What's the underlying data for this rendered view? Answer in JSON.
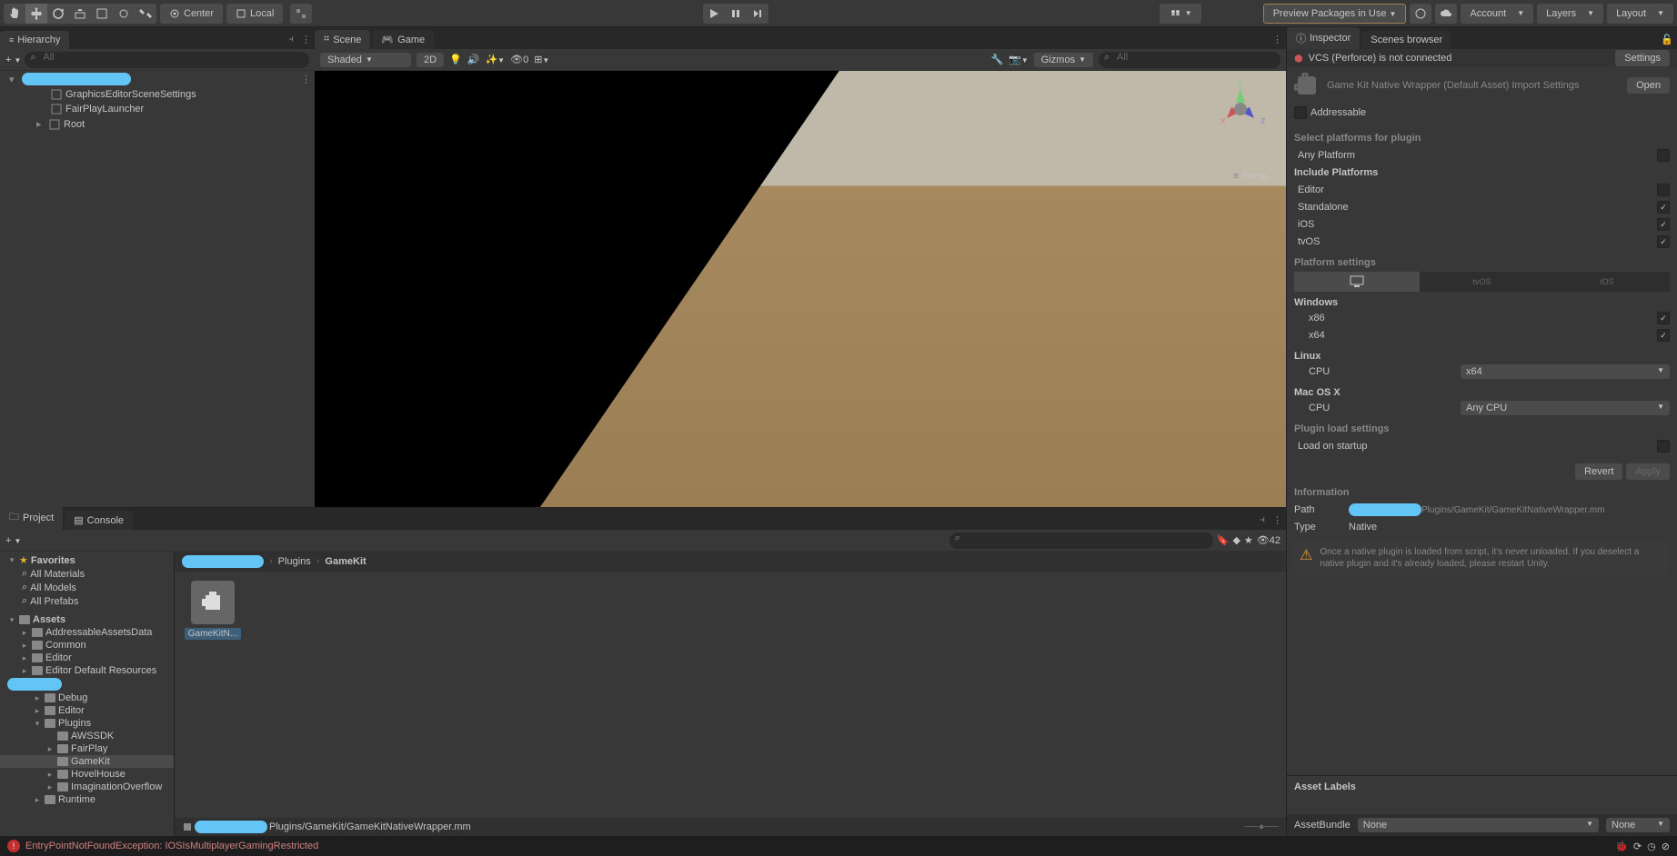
{
  "toolbar": {
    "pivot": "Center",
    "handle": "Local",
    "preview": "Preview Packages in Use",
    "account": "Account",
    "layers": "Layers",
    "layout": "Layout"
  },
  "hierarchy": {
    "title": "Hierarchy",
    "search_placeholder": "All",
    "items": [
      {
        "name": "GraphicsEditorSceneSettings",
        "indent": 2
      },
      {
        "name": "FairPlayLauncher",
        "indent": 2
      },
      {
        "name": "Root",
        "indent": 1
      }
    ]
  },
  "scene": {
    "tab_scene": "Scene",
    "tab_game": "Game",
    "shading": "Shaded",
    "twod": "2D",
    "gizmos": "Gizmos",
    "search_placeholder": "All",
    "proj": "Persp",
    "zero": "0"
  },
  "project": {
    "tab_project": "Project",
    "tab_console": "Console",
    "hidden_count": "42",
    "favorites": "Favorites",
    "fav_items": [
      "All Materials",
      "All Models",
      "All Prefabs"
    ],
    "assets": "Assets",
    "tree": [
      {
        "name": "AddressableAssetsData",
        "indent": 1,
        "arrow": "▸"
      },
      {
        "name": "Common",
        "indent": 1,
        "arrow": "▸"
      },
      {
        "name": "Editor",
        "indent": 1,
        "arrow": "▸"
      },
      {
        "name": "Editor Default Resources",
        "indent": 1,
        "arrow": "▸"
      },
      {
        "name": "Debug",
        "indent": 2,
        "arrow": "▸"
      },
      {
        "name": "Editor",
        "indent": 2,
        "arrow": "▸"
      },
      {
        "name": "Plugins",
        "indent": 2,
        "arrow": "▾"
      },
      {
        "name": "AWSSDK",
        "indent": 3,
        "arrow": ""
      },
      {
        "name": "FairPlay",
        "indent": 3,
        "arrow": "▸"
      },
      {
        "name": "GameKit",
        "indent": 3,
        "arrow": "",
        "sel": true
      },
      {
        "name": "HovelHouse",
        "indent": 3,
        "arrow": "▸"
      },
      {
        "name": "ImaginationOverflow",
        "indent": 3,
        "arrow": "▸"
      },
      {
        "name": "Runtime",
        "indent": 2,
        "arrow": "▸"
      }
    ],
    "breadcrumb": {
      "plugins": "Plugins",
      "gamekit": "GameKit",
      "sep": "›"
    },
    "asset_thumb": "GameKitN...",
    "path_suffix": "Plugins/GameKit/GameKitNativeWrapper.mm"
  },
  "inspector": {
    "tab_inspector": "Inspector",
    "tab_scenes": "Scenes browser",
    "vcs": "VCS (Perforce) is not connected",
    "settings": "Settings",
    "title": "Game Kit Native Wrapper (Default Asset) Import Settings",
    "open": "Open",
    "addressable": "Addressable",
    "select_platforms": "Select platforms for plugin",
    "any_platform": "Any Platform",
    "include_platforms": "Include Platforms",
    "platforms": [
      {
        "name": "Editor",
        "checked": false
      },
      {
        "name": "Standalone",
        "checked": true
      },
      {
        "name": "iOS",
        "checked": true
      },
      {
        "name": "tvOS",
        "checked": true
      }
    ],
    "platform_settings": "Platform settings",
    "platform_tabs": [
      "",
      "tvOS",
      "iOS"
    ],
    "windows": "Windows",
    "x86": "x86",
    "x64": "x64",
    "linux": "Linux",
    "cpu": "CPU",
    "linux_cpu": "x64",
    "mac": "Mac OS X",
    "mac_cpu": "Any CPU",
    "plugin_load": "Plugin load settings",
    "load_startup": "Load on startup",
    "revert": "Revert",
    "apply": "Apply",
    "information": "Information",
    "path_label": "Path",
    "path_suffix": "Plugins/GameKit/GameKitNativeWrapper.mm",
    "type_label": "Type",
    "type_val": "Native",
    "warning": "Once a native plugin is loaded from script, it's never unloaded. If you deselect a native plugin and it's already loaded, please restart Unity.",
    "asset_labels": "Asset Labels",
    "asset_bundle": "AssetBundle",
    "none": "None"
  },
  "error": "EntryPointNotFoundException: IOSIsMultiplayerGamingRestricted"
}
